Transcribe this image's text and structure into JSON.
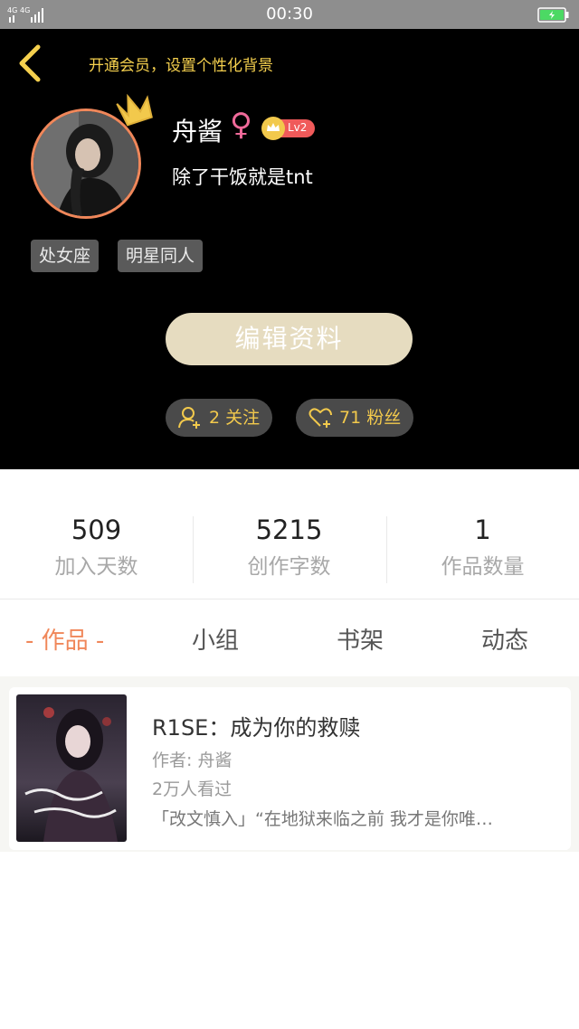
{
  "status_bar": {
    "network": "4G 4G",
    "time": "00:30"
  },
  "header": {
    "vip_prompt": "开通会员，设置个性化背景",
    "username": "舟酱",
    "gender_symbol": "♀",
    "level": "Lv2",
    "bio": "除了干饭就是tnt",
    "tags": [
      "处女座",
      "明星同人"
    ],
    "edit_button": "编辑资料",
    "follow_count": "2",
    "follow_label": "关注",
    "fans_count": "71",
    "fans_label": "粉丝"
  },
  "stats": [
    {
      "value": "509",
      "label": "加入天数"
    },
    {
      "value": "5215",
      "label": "创作字数"
    },
    {
      "value": "1",
      "label": "作品数量"
    }
  ],
  "tabs": [
    {
      "label": "- 作品 -",
      "active": true
    },
    {
      "label": "小组",
      "active": false
    },
    {
      "label": "书架",
      "active": false
    },
    {
      "label": "动态",
      "active": false
    }
  ],
  "works": [
    {
      "title": "R1SE：成为你的救赎",
      "author": "作者: 舟酱",
      "views": "2万人看过",
      "description": "「改文慎入」“在地狱来临之前 我才是你唯…"
    }
  ],
  "colors": {
    "accent": "#f0875a",
    "gold": "#f2c94c",
    "header_bg": "#000000",
    "edit_button_bg": "#e6dcc0"
  }
}
